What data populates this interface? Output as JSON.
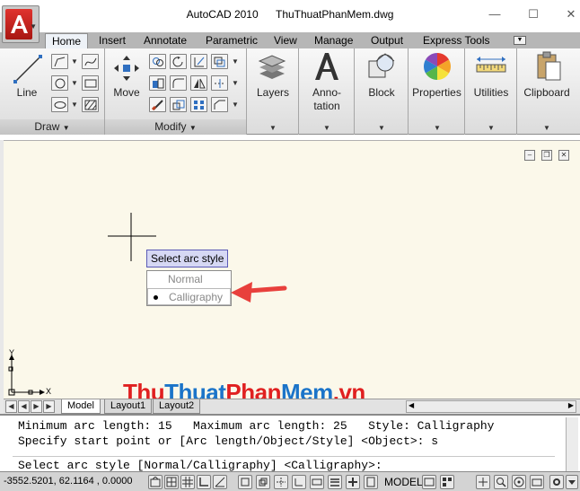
{
  "window": {
    "app_name": "AutoCAD 2010",
    "file_name": "ThuThuatPhanMem.dwg"
  },
  "ribbon": {
    "tabs": [
      "Home",
      "Insert",
      "Annotate",
      "Parametric",
      "View",
      "Manage",
      "Output",
      "Express Tools"
    ],
    "active_tab": "Home",
    "panels": {
      "draw": {
        "title": "Draw",
        "line_label": "Line"
      },
      "modify": {
        "title": "Modify",
        "move_label": "Move"
      },
      "layers": {
        "label": "Layers"
      },
      "annotation": {
        "label_line1": "Anno-",
        "label_line2": "tation"
      },
      "block": {
        "label": "Block"
      },
      "properties": {
        "label": "Properties"
      },
      "utilities": {
        "label": "Utilities"
      },
      "clipboard": {
        "label": "Clipboard"
      }
    }
  },
  "drawing": {
    "background_color": "#fbf8ea",
    "arc_menu": {
      "title": "Select arc style",
      "options": [
        "Normal",
        "Calligraphy"
      ],
      "selected": "Calligraphy"
    },
    "ucs": {
      "x_label": "X",
      "y_label": "Y"
    }
  },
  "layout_tabs": [
    "Model",
    "Layout1",
    "Layout2"
  ],
  "watermark": {
    "part1": "Thu",
    "part2": "Thuat",
    "part3": "Phan",
    "part4": "Mem",
    "part5": ".vn"
  },
  "command_line": {
    "line1": "Minimum arc length: 15   Maximum arc length: 25   Style: Calligraphy",
    "line2": "Specify start point or [Arc length/Object/Style] <Object>: s",
    "prompt": "Select arc style [Normal/Calligraphy] <Calligraphy>:"
  },
  "status_bar": {
    "coordinates": "-3552.5201, 62.1164 , 0.0000",
    "space": "MODEL"
  },
  "colors": {
    "accent_red": "#e8403c",
    "watermark_red": "#e02020",
    "watermark_blue": "#1b74c9"
  }
}
